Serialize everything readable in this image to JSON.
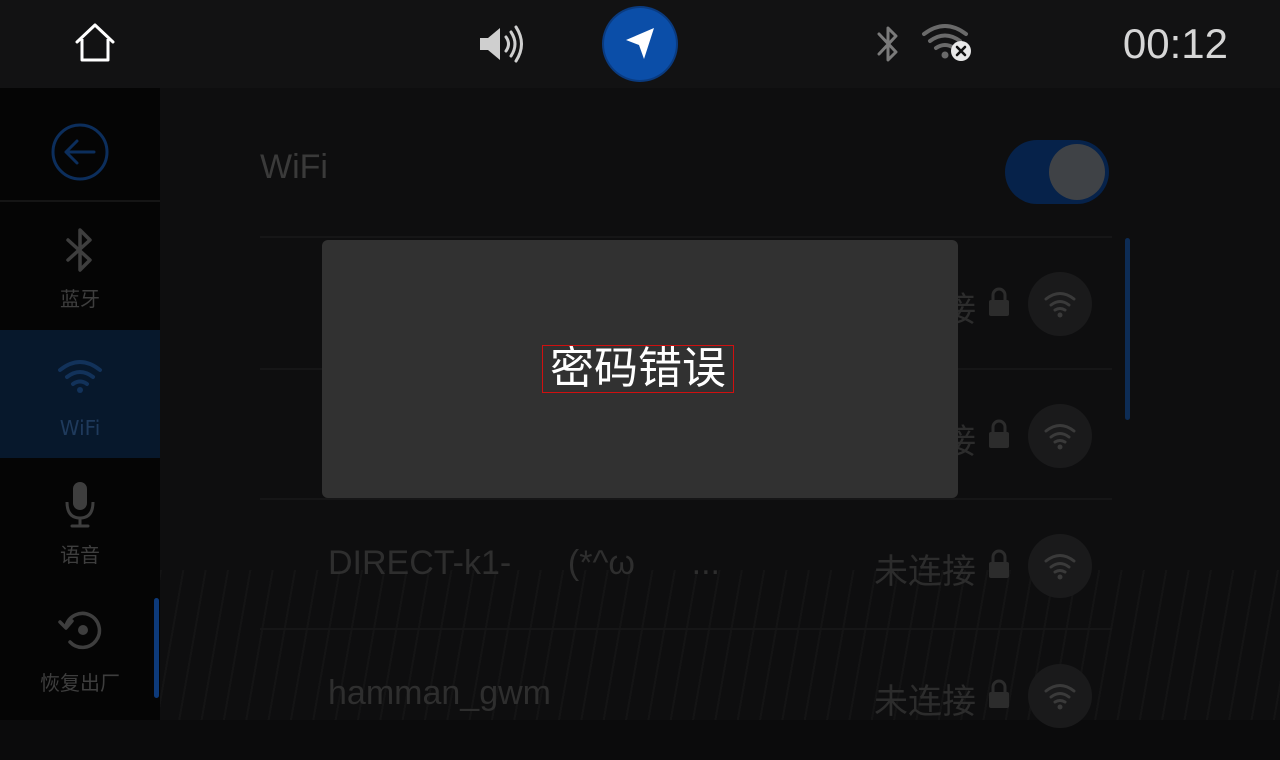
{
  "status_bar": {
    "time": "00:12",
    "icons": [
      "home-icon",
      "volume-icon",
      "navigation-icon",
      "bluetooth-icon",
      "wifi-disconnected-icon"
    ],
    "nav_color": "#0b4ea8"
  },
  "sidebar": {
    "back_icon": "back-arrow-icon",
    "items": [
      {
        "label": "蓝牙",
        "icon": "bluetooth-icon",
        "active": false
      },
      {
        "label": "WiFi",
        "icon": "wifi-icon",
        "active": true
      },
      {
        "label": "语音",
        "icon": "microphone-icon",
        "active": false
      },
      {
        "label": "恢复出厂",
        "icon": "factory-reset-icon",
        "active": false
      }
    ]
  },
  "wifi_page": {
    "title": "WiFi",
    "enabled": true,
    "networks": [
      {
        "name": "",
        "status": "接",
        "secured": true
      },
      {
        "name": "",
        "status": "接",
        "secured": true
      },
      {
        "name": "DIRECT-k1-      (*^ω      ...",
        "status": "未连接",
        "secured": true
      },
      {
        "name": "hamman_gwm",
        "status": "未连接",
        "secured": true
      }
    ]
  },
  "dialog": {
    "message": "密码错误"
  },
  "colors": {
    "accent": "#0b4ea8",
    "dialog_bg": "#313131",
    "background": "#0b0b0c"
  }
}
